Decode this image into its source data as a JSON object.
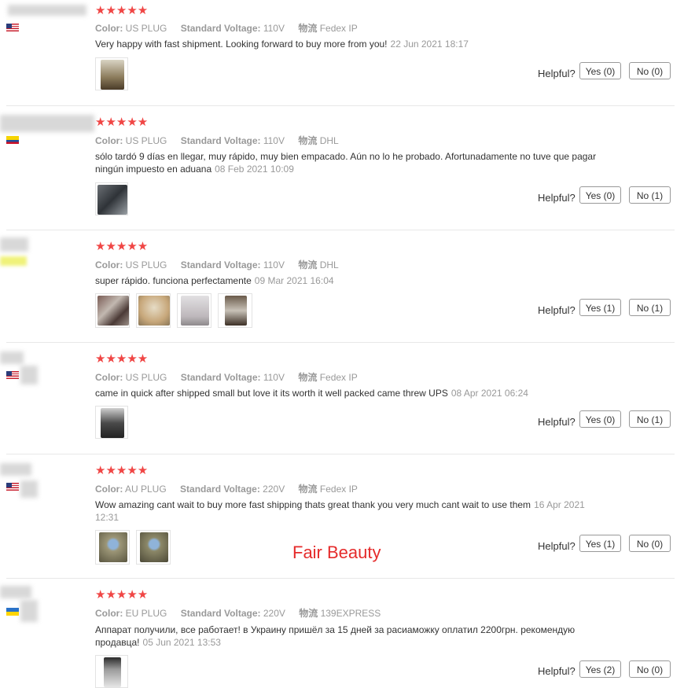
{
  "labels": {
    "color": "Color:",
    "voltage": "Standard Voltage:",
    "logistics": "物流",
    "helpful": "Helpful?"
  },
  "star_glyph": "★★★★★",
  "watermark": "Fair Beauty",
  "reviews": [
    {
      "flag": "us",
      "stars": 5,
      "color": "US PLUG",
      "voltage": "110V",
      "logistics": "Fedex IP",
      "text": "Very happy with fast shipment. Looking forward to buy more from you!",
      "date": "22 Jun 2021 18:17",
      "yes": "Yes (0)",
      "no": "No (0)"
    },
    {
      "flag": "co",
      "stars": 5,
      "color": "US PLUG",
      "voltage": "110V",
      "logistics": "DHL",
      "text": "sólo tardó 9 días en llegar, muy rápido, muy bien empacado. Aún no lo he probado. Afortunadamente no tuve que pagar ningún impuesto en aduana",
      "date": "08 Feb 2021 10:09",
      "yes": "Yes (0)",
      "no": "No (1)"
    },
    {
      "flag": "yel",
      "stars": 5,
      "color": "US PLUG",
      "voltage": "110V",
      "logistics": "DHL",
      "text": "super rápido. funciona perfectamente",
      "date": "09 Mar 2021 16:04",
      "yes": "Yes (1)",
      "no": "No (1)"
    },
    {
      "flag": "us",
      "stars": 5,
      "color": "US PLUG",
      "voltage": "110V",
      "logistics": "Fedex IP",
      "text": "came in quick after shipped small but love it its worth it well packed came threw UPS",
      "date": "08 Apr 2021 06:24",
      "yes": "Yes (0)",
      "no": "No (1)"
    },
    {
      "flag": "us",
      "stars": 5,
      "color": "AU PLUG",
      "voltage": "220V",
      "logistics": "Fedex IP",
      "text": "Wow amazing cant wait to buy more fast shipping thats great thank you very much cant wait to use them",
      "date": "16 Apr 2021 12:31",
      "yes": "Yes (1)",
      "no": "No (0)"
    },
    {
      "flag": "ua",
      "stars": 5,
      "color": "EU PLUG",
      "voltage": "220V",
      "logistics": "139EXPRESS",
      "text": "Аппарат получили, все работает! в Украину пришёл за 15 дней за расиаможку оплатил 2200грн. рекомендую продавца!",
      "date": "05 Jun 2021 13:53",
      "yes": "Yes (2)",
      "no": "No (0)"
    }
  ],
  "photo_colors": {
    "r0": [
      "#8a7a5a"
    ],
    "r1": [
      "#3a3f44"
    ],
    "r2": [
      "#6b4f4a",
      "#d4c6a8",
      "#c9c3c6",
      "#5a4a3e"
    ],
    "r3": [
      "#4a4a4a"
    ],
    "r4": [
      "#8c8a6a",
      "#7a7760"
    ],
    "r5": [
      "#6a6a6a"
    ]
  }
}
